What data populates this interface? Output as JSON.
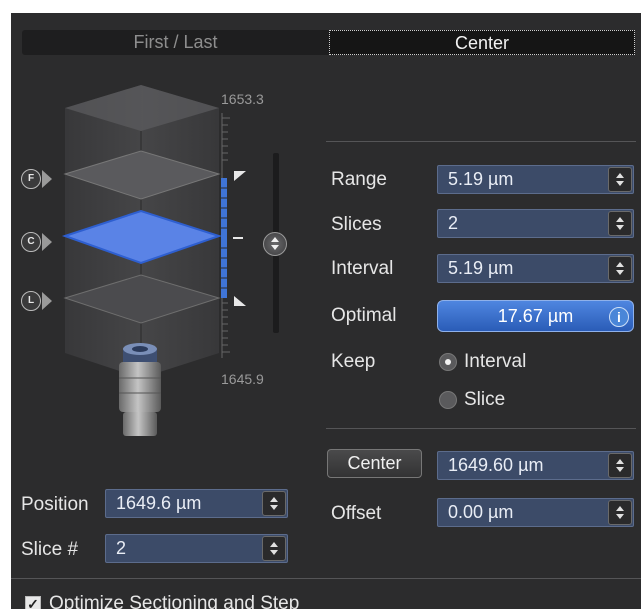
{
  "tabs": {
    "first_last": "First / Last",
    "center": "Center"
  },
  "stack": {
    "top_value": "1653.3",
    "bottom_value": "1645.9",
    "markers": {
      "first": "F",
      "center": "C",
      "last": "L"
    }
  },
  "params": {
    "range_label": "Range",
    "range_value": "5.19 µm",
    "slices_label": "Slices",
    "slices_value": "2",
    "interval_label": "Interval",
    "interval_value": "5.19 µm",
    "optimal_label": "Optimal",
    "optimal_value": "17.67 µm",
    "info_glyph": "i",
    "keep_label": "Keep",
    "keep_options": [
      "Interval",
      "Slice"
    ],
    "keep_selected": "Interval"
  },
  "center_section": {
    "center_button": "Center",
    "center_value": "1649.60 µm",
    "offset_label": "Offset",
    "offset_value": "0.00 µm"
  },
  "position": {
    "position_label": "Position",
    "position_value": "1649.6 µm",
    "slice_label": "Slice #",
    "slice_value": "2"
  },
  "footer": {
    "optimize_label": "Optimize Sectioning and Step",
    "optimize_checked": true
  },
  "colors": {
    "panel": "#2c2c2d",
    "field": "#3c4b68",
    "accent": "#3f74d6",
    "active_plane": "#5a83e6"
  }
}
